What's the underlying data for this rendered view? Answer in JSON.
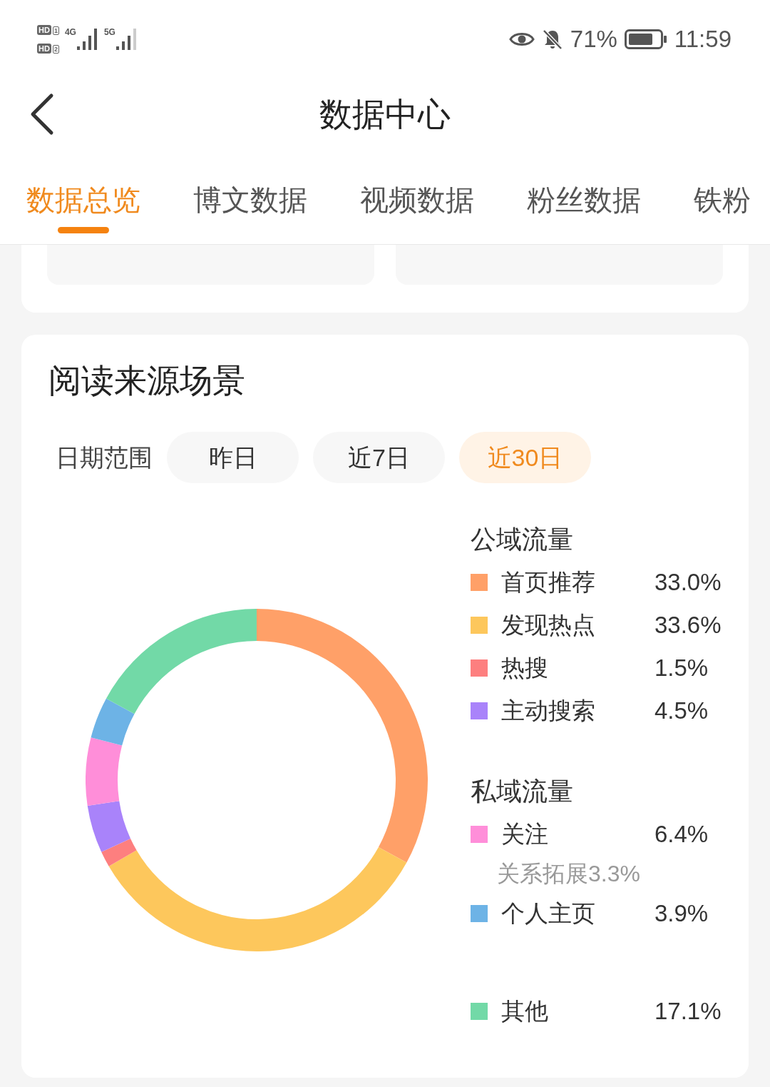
{
  "status_bar": {
    "sims": [
      {
        "badge": "HD",
        "slot": "1"
      },
      {
        "badge": "HD",
        "slot": "2"
      }
    ],
    "networks": [
      "4G",
      "5G"
    ],
    "battery": "71%",
    "time": "11:59"
  },
  "header": {
    "title": "数据中心"
  },
  "tabs": [
    {
      "label": "数据总览",
      "selected": true
    },
    {
      "label": "博文数据",
      "selected": false
    },
    {
      "label": "视频数据",
      "selected": false
    },
    {
      "label": "粉丝数据",
      "selected": false
    },
    {
      "label": "铁粉",
      "selected": false
    }
  ],
  "reading_sources": {
    "title": "阅读来源场景",
    "date_range": {
      "label": "日期范围",
      "options": [
        {
          "label": "昨日",
          "selected": false
        },
        {
          "label": "近7日",
          "selected": false
        },
        {
          "label": "近30日",
          "selected": true
        }
      ]
    },
    "chart_data": {
      "type": "donut",
      "categories": [
        "首页推荐",
        "发现热点",
        "热搜",
        "主动搜索",
        "关注",
        "个人主页",
        "其他"
      ],
      "values": [
        33.0,
        33.6,
        1.5,
        4.5,
        6.4,
        3.9,
        17.1
      ],
      "legend": "right"
    },
    "legend": [
      {
        "title": "公域流量",
        "items": [
          {
            "value": "33.0%",
            "color": "#ffa068"
          },
          {
            "value": "33.6%",
            "color": "#fdc75c"
          },
          {
            "value": "1.5%",
            "color": "#fd7f7f"
          },
          {
            "value": "4.5%",
            "color": "#a983fa"
          }
        ]
      },
      {
        "title": "私域流量",
        "items": [
          {
            "value": "6.4%",
            "color": "#ff8ed9",
            "note": "关系拓展3.3%"
          },
          {
            "value": "3.9%",
            "color": "#6db3e6"
          }
        ]
      },
      {
        "items": [
          {
            "value": "17.1%",
            "color": "#72d9a7"
          }
        ]
      }
    ]
  }
}
